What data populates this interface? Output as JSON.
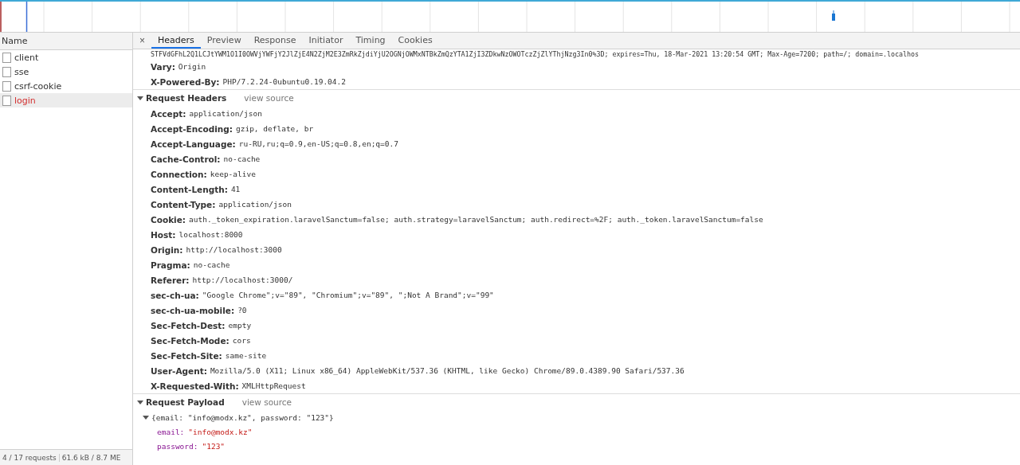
{
  "requests_panel": {
    "column": "Name",
    "rows": [
      {
        "name": "client",
        "selected": false,
        "failed": false
      },
      {
        "name": "sse",
        "selected": false,
        "failed": false
      },
      {
        "name": "csrf-cookie",
        "selected": false,
        "failed": false
      },
      {
        "name": "login",
        "selected": true,
        "failed": true
      }
    ],
    "status_bar": {
      "requests": "4 / 17 requests",
      "size": "61.6 kB / 8.7 ME"
    }
  },
  "details": {
    "close": "×",
    "tabs": [
      {
        "label": "Headers",
        "selected": true
      },
      {
        "label": "Preview",
        "selected": false
      },
      {
        "label": "Response",
        "selected": false
      },
      {
        "label": "Initiator",
        "selected": false
      },
      {
        "label": "Timing",
        "selected": false
      },
      {
        "label": "Cookies",
        "selected": false
      }
    ],
    "cut_line": "STFVdGFhL2Q1LCJtYWM1O1I0OWVjYWFjY2JlZjE4N2ZjM2E3ZmRkZjdiYjU2OGNjOWMxNTBkZmQzYTA1ZjI3ZDkwNzOWOTczZjZlYThjNzg3In0%3D; expires=Thu, 18-Mar-2021 13:20:54 GMT; Max-Age=7200; path=/; domain=.localhos",
    "response_headers": [
      {
        "key": "Vary:",
        "value": "Origin"
      },
      {
        "key": "X-Powered-By:",
        "value": "PHP/7.2.24-0ubuntu0.19.04.2"
      }
    ],
    "sections": [
      {
        "title": "Request Headers",
        "view_source": "view source",
        "expanded": true,
        "headers": [
          {
            "key": "Accept:",
            "value": "application/json"
          },
          {
            "key": "Accept-Encoding:",
            "value": "gzip, deflate, br"
          },
          {
            "key": "Accept-Language:",
            "value": "ru-RU,ru;q=0.9,en-US;q=0.8,en;q=0.7"
          },
          {
            "key": "Cache-Control:",
            "value": "no-cache"
          },
          {
            "key": "Connection:",
            "value": "keep-alive"
          },
          {
            "key": "Content-Length:",
            "value": "41"
          },
          {
            "key": "Content-Type:",
            "value": "application/json"
          },
          {
            "key": "Cookie:",
            "value": "auth._token_expiration.laravelSanctum=false; auth.strategy=laravelSanctum; auth.redirect=%2F; auth._token.laravelSanctum=false"
          },
          {
            "key": "Host:",
            "value": "localhost:8000"
          },
          {
            "key": "Origin:",
            "value": "http://localhost:3000"
          },
          {
            "key": "Pragma:",
            "value": "no-cache"
          },
          {
            "key": "Referer:",
            "value": "http://localhost:3000/"
          },
          {
            "key": "sec-ch-ua:",
            "value": "\"Google Chrome\";v=\"89\", \"Chromium\";v=\"89\", \";Not A Brand\";v=\"99\""
          },
          {
            "key": "sec-ch-ua-mobile:",
            "value": "?0"
          },
          {
            "key": "Sec-Fetch-Dest:",
            "value": "empty"
          },
          {
            "key": "Sec-Fetch-Mode:",
            "value": "cors"
          },
          {
            "key": "Sec-Fetch-Site:",
            "value": "same-site"
          },
          {
            "key": "User-Agent:",
            "value": "Mozilla/5.0 (X11; Linux x86_64) AppleWebKit/537.36 (KHTML, like Gecko) Chrome/89.0.4389.90 Safari/537.36"
          },
          {
            "key": "X-Requested-With:",
            "value": "XMLHttpRequest"
          }
        ]
      },
      {
        "title": "Request Payload",
        "view_source": "view source",
        "expanded": true,
        "payload": {
          "summary": "{email: \"info@modx.kz\", password: \"123\"}",
          "expanded": true,
          "fields": [
            {
              "key": "email:",
              "value": "\"info@modx.kz\""
            },
            {
              "key": "password:",
              "value": "\"123\""
            }
          ]
        }
      }
    ]
  }
}
